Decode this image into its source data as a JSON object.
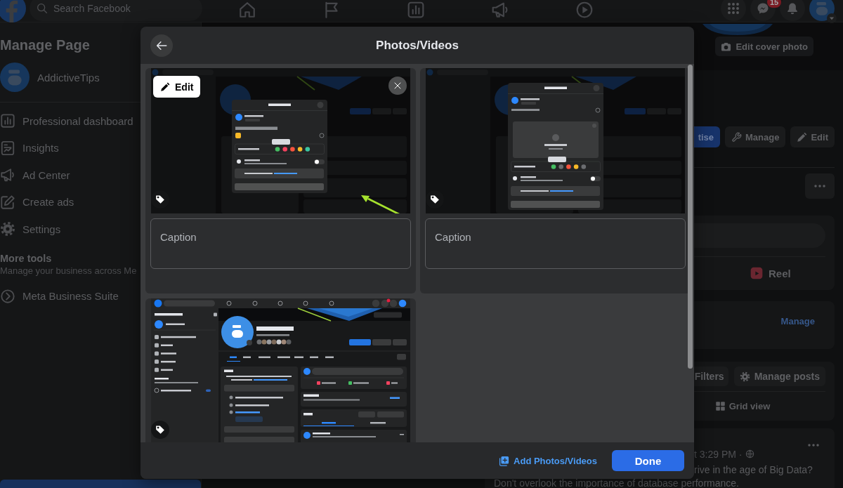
{
  "top_bar": {
    "search": {
      "placeholder": "Search Facebook"
    },
    "message_badge": "15"
  },
  "sidebar": {
    "title": "Manage Page",
    "page_name": "AddictiveTips",
    "items": [
      "Professional dashboard",
      "Insights",
      "Ad Center",
      "Create ads",
      "Settings"
    ],
    "more_tools_title": "More tools",
    "more_tools_note": "Manage your business across Me",
    "suite_label": "Meta Business Suite"
  },
  "page": {
    "edit_cover": "Edit cover photo",
    "actions": [
      {
        "label": "tise",
        "kind": "primary"
      },
      {
        "label": "Manage",
        "kind": "secondary"
      },
      {
        "label": "Edit",
        "kind": "secondary"
      }
    ],
    "composer_action": "Reel",
    "featured_link": "Manage",
    "filters": "Filters",
    "manage_posts": "Manage posts",
    "grid_view": "Grid view",
    "post_meta": "t 3:29 PM ·",
    "post_lines": [
      "rive in the age of Big Data?",
      "Don't overlook the importance of database performance."
    ]
  },
  "dialog": {
    "title": "Photos/Videos",
    "items": [
      {
        "kind": "post_dialog",
        "hovered": true,
        "edit_label": "Edit",
        "caption": {
          "placeholder": "Caption"
        }
      },
      {
        "kind": "post_dialog_upload",
        "hovered": false,
        "caption": {
          "placeholder": "Caption"
        }
      },
      {
        "kind": "page",
        "hovered": false
      }
    ],
    "add_link": "Add Photos/Videos",
    "done_button": "Done"
  }
}
